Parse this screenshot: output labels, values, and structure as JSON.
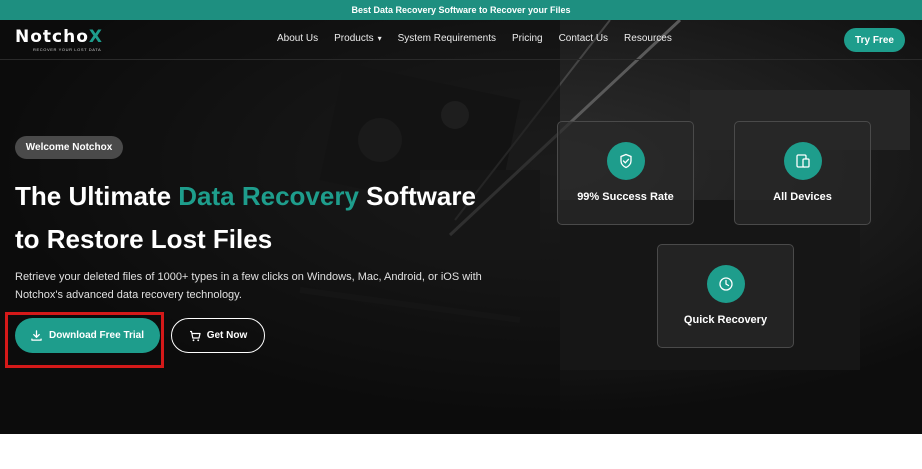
{
  "announcement": {
    "text": "Best Data Recovery Software to Recover your Files"
  },
  "brand": {
    "name_main": "Notcho",
    "name_x": "X",
    "tagline": "RECOVER YOUR LOST DATA"
  },
  "nav": {
    "items": [
      {
        "label": "About Us"
      },
      {
        "label": "Products",
        "icon": "chevron-down-icon"
      },
      {
        "label": "System Requirements"
      },
      {
        "label": "Pricing"
      },
      {
        "label": "Contact Us"
      },
      {
        "label": "Resources"
      }
    ],
    "cta_label": "Try Free"
  },
  "hero": {
    "badge": "Welcome Notchox",
    "headline_part1": "The Ultimate ",
    "headline_accent": "Data Recovery",
    "headline_part2": " Software",
    "headline_line2": "to Restore Lost Files",
    "description": "Retrieve your deleted files of 1000+ types in a few clicks on Windows, Mac, Android, or iOS with Notchox's advanced data recovery technology.",
    "primary_button": {
      "label": "Download Free Trial",
      "icon": "download-icon"
    },
    "secondary_button": {
      "label": "Get Now",
      "icon": "cart-icon"
    }
  },
  "features": [
    {
      "label": "99% Success Rate",
      "icon": "shield-check-icon"
    },
    {
      "label": "All Devices",
      "icon": "devices-icon"
    },
    {
      "label": "Quick Recovery",
      "icon": "clock-icon"
    }
  ],
  "colors": {
    "accent": "#1e9d8c",
    "highlight": "#d41919",
    "background": "#0d0d0d"
  }
}
